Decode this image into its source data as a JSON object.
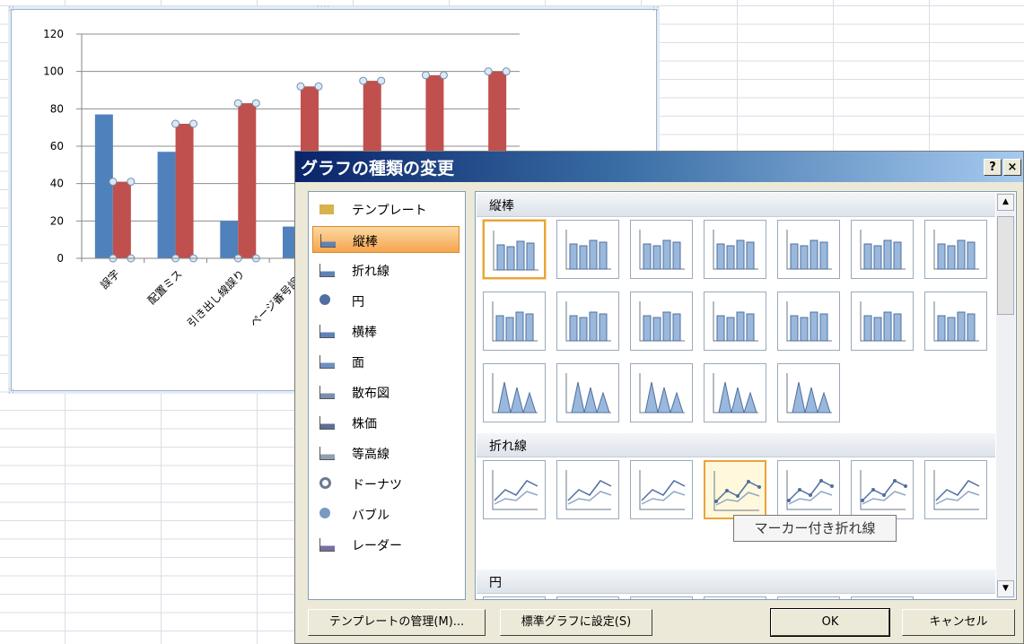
{
  "chart_data": {
    "type": "bar",
    "categories": [
      "誤字",
      "配置ミス",
      "引き出し線誤り",
      "ページ番号誤り",
      "",
      "",
      ""
    ],
    "series": [
      {
        "values": [
          77,
          57,
          20,
          17,
          null,
          null,
          null
        ],
        "color": "#4f81bd"
      },
      {
        "values": [
          41,
          72,
          83,
          92,
          95,
          98,
          100
        ],
        "color": "#c0504d"
      }
    ],
    "ylim": [
      0,
      120
    ],
    "yticks": [
      "0",
      "20",
      "40",
      "60",
      "80",
      "100",
      "120"
    ],
    "grid": true
  },
  "dialog": {
    "title": "グラフの種類の変更",
    "help_label": "?",
    "close_label": "×",
    "chart_types": [
      {
        "label": "テンプレート",
        "icon": "folder-icon"
      },
      {
        "label": "縦棒",
        "icon": "column-chart-icon",
        "selected": true
      },
      {
        "label": "折れ線",
        "icon": "line-chart-icon"
      },
      {
        "label": "円",
        "icon": "pie-chart-icon"
      },
      {
        "label": "横棒",
        "icon": "bar-chart-icon"
      },
      {
        "label": "面",
        "icon": "area-chart-icon"
      },
      {
        "label": "散布図",
        "icon": "scatter-chart-icon"
      },
      {
        "label": "株価",
        "icon": "stock-chart-icon"
      },
      {
        "label": "等高線",
        "icon": "surface-chart-icon"
      },
      {
        "label": "ドーナツ",
        "icon": "doughnut-chart-icon"
      },
      {
        "label": "バブル",
        "icon": "bubble-chart-icon"
      },
      {
        "label": "レーダー",
        "icon": "radar-chart-icon"
      }
    ],
    "sections": {
      "column": "縦棒",
      "line": "折れ線",
      "pie": "円"
    },
    "tooltip": "マーカー付き折れ線",
    "buttons": {
      "manage_templates": "テンプレートの管理(M)...",
      "set_default": "標準グラフに設定(S)",
      "ok": "OK",
      "cancel": "キャンセル"
    },
    "accent_color": "#e9a43b"
  }
}
